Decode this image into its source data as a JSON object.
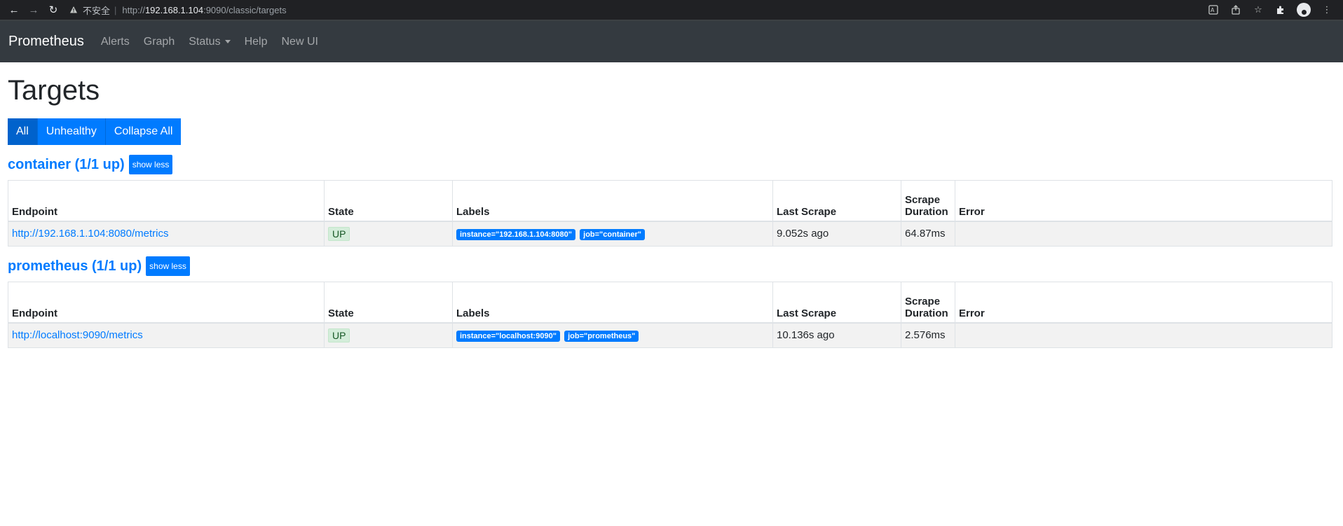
{
  "browser": {
    "insecure_text": "不安全",
    "url_scheme": "http://",
    "url_host": "192.168.1.104",
    "url_rest": ":9090/classic/targets"
  },
  "navbar": {
    "brand": "Prometheus",
    "links": [
      "Alerts",
      "Graph",
      "Status",
      "Help",
      "New UI"
    ]
  },
  "page": {
    "title": "Targets",
    "filters": [
      "All",
      "Unhealthy",
      "Collapse All"
    ]
  },
  "table_headers": {
    "endpoint": "Endpoint",
    "state": "State",
    "labels": "Labels",
    "last_scrape": "Last Scrape",
    "scrape_duration_1": "Scrape",
    "scrape_duration_2": "Duration",
    "error": "Error"
  },
  "jobs": [
    {
      "title": "container (1/1 up)",
      "toggle": "show less",
      "endpoint": "http://192.168.1.104:8080/metrics",
      "state": "UP",
      "labels": [
        "instance=\"192.168.1.104:8080\"",
        "job=\"container\""
      ],
      "last_scrape": "9.052s ago",
      "scrape_duration": "64.87ms",
      "error": ""
    },
    {
      "title": "prometheus (1/1 up)",
      "toggle": "show less",
      "endpoint": "http://localhost:9090/metrics",
      "state": "UP",
      "labels": [
        "instance=\"localhost:9090\"",
        "job=\"prometheus\""
      ],
      "last_scrape": "10.136s ago",
      "scrape_duration": "2.576ms",
      "error": ""
    }
  ],
  "colors": {
    "primary": "#007bff",
    "navbar_bg": "#343a40",
    "up_badge_bg": "#d4edda"
  }
}
